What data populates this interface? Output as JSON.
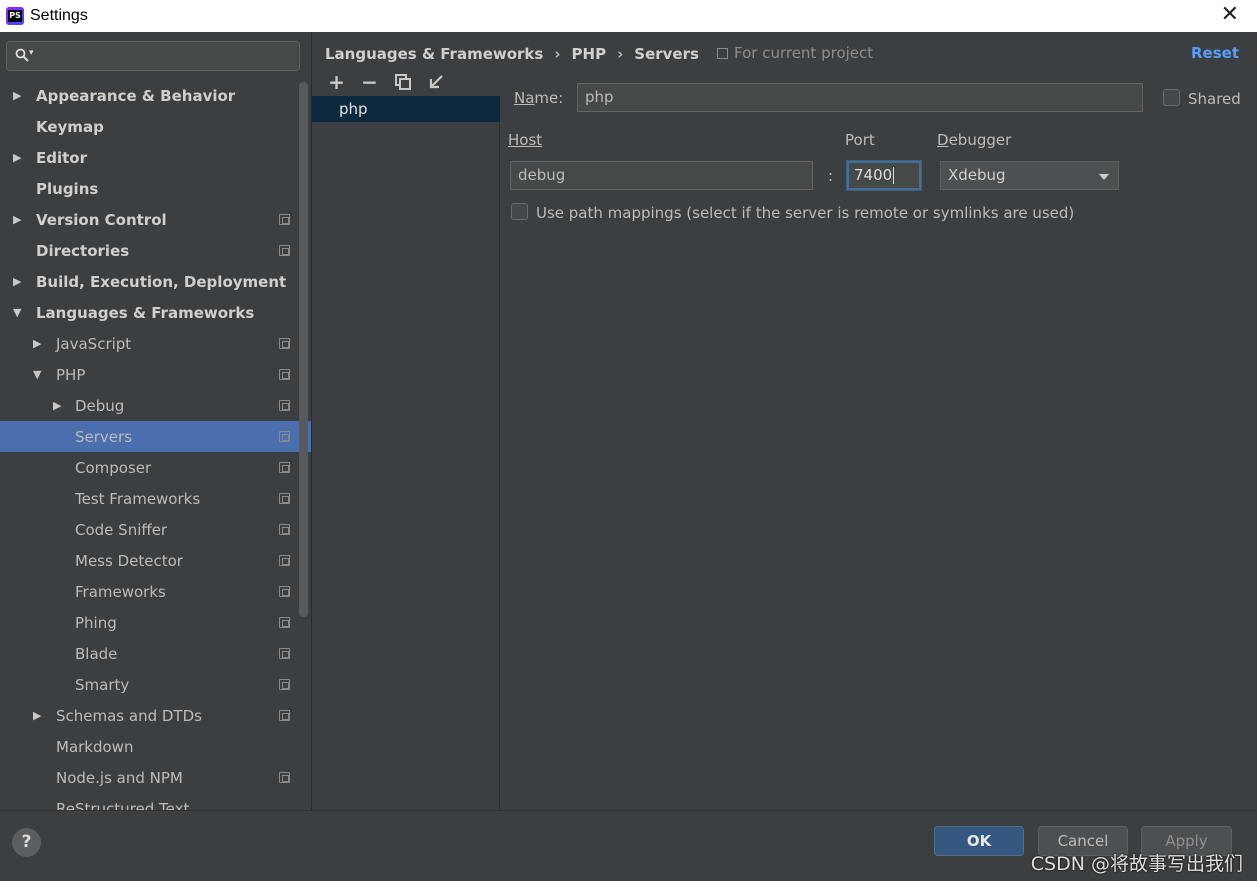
{
  "window": {
    "title": "Settings"
  },
  "sidebar": {
    "search_value": "",
    "items": [
      {
        "label": "Appearance & Behavior",
        "arrow": "▶"
      },
      {
        "label": "Keymap",
        "arrow": ""
      },
      {
        "label": "Editor",
        "arrow": "▶"
      },
      {
        "label": "Plugins",
        "arrow": ""
      },
      {
        "label": "Version Control",
        "arrow": "▶"
      },
      {
        "label": "Directories",
        "arrow": ""
      },
      {
        "label": "Build, Execution, Deployment",
        "arrow": "▶"
      },
      {
        "label": "Languages & Frameworks",
        "arrow": "▼"
      },
      {
        "label": "JavaScript",
        "arrow": "▶"
      },
      {
        "label": "PHP",
        "arrow": "▼"
      },
      {
        "label": "Debug",
        "arrow": "▶"
      },
      {
        "label": "Servers",
        "arrow": ""
      },
      {
        "label": "Composer",
        "arrow": ""
      },
      {
        "label": "Test Frameworks",
        "arrow": ""
      },
      {
        "label": "Code Sniffer",
        "arrow": ""
      },
      {
        "label": "Mess Detector",
        "arrow": ""
      },
      {
        "label": "Frameworks",
        "arrow": ""
      },
      {
        "label": "Phing",
        "arrow": ""
      },
      {
        "label": "Blade",
        "arrow": ""
      },
      {
        "label": "Smarty",
        "arrow": ""
      },
      {
        "label": "Schemas and DTDs",
        "arrow": "▶"
      },
      {
        "label": "Markdown",
        "arrow": ""
      },
      {
        "label": "Node.js and NPM",
        "arrow": ""
      },
      {
        "label": "ReStructured Text",
        "arrow": ""
      }
    ]
  },
  "breadcrumb": {
    "items": [
      "Languages & Frameworks",
      "PHP",
      "Servers"
    ],
    "separator": "›"
  },
  "scope_note": "For current project",
  "reset_label": "Reset",
  "toolbar": {
    "add": "+",
    "remove": "−"
  },
  "servers": [
    "php"
  ],
  "form": {
    "name_label": "Name:",
    "name_value": "php",
    "shared_label": "Shared",
    "host_label": "Host",
    "host_value": "debug",
    "colon": ":",
    "port_label": "Port",
    "port_value": "7400",
    "debugger_label": "Debugger",
    "debugger_value": "Xdebug",
    "path_mappings_label": "Use path mappings (select if the server is remote or symlinks are used)"
  },
  "buttons": {
    "help": "?",
    "ok": "OK",
    "cancel": "Cancel",
    "apply": "Apply"
  },
  "watermark": "CSDN @将故事写出我们"
}
